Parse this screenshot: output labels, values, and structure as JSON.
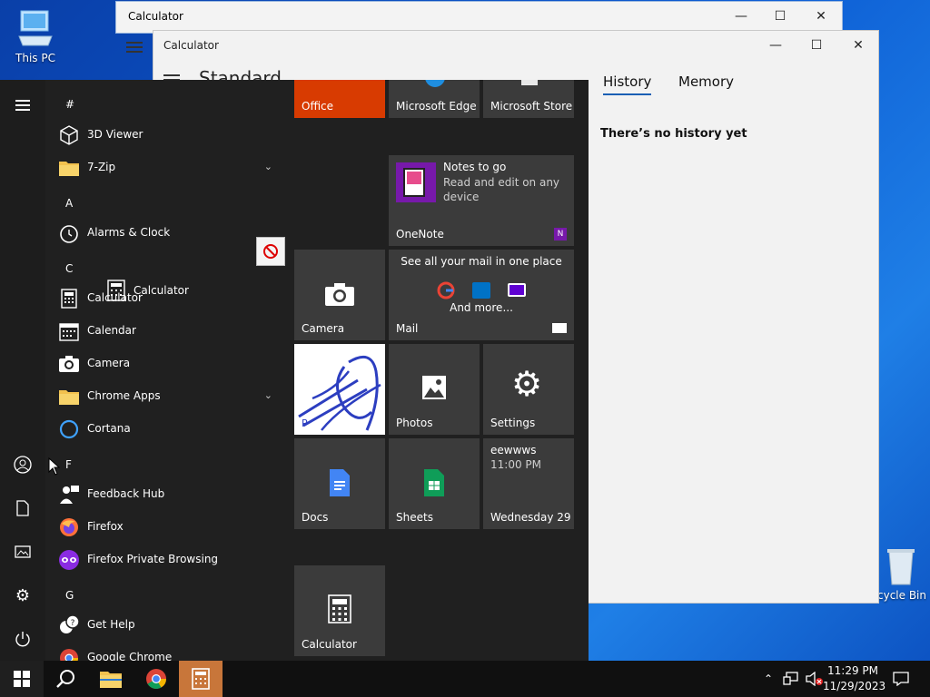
{
  "desktop": {
    "this_pc": "This PC",
    "recycle_bin": "cycle Bin"
  },
  "back_window": {
    "title": "Calculator"
  },
  "calculator": {
    "title": "Calculator",
    "mode": "Standard",
    "tab_history": "History",
    "tab_memory": "Memory",
    "history_empty": "There’s no history yet"
  },
  "start_menu": {
    "letters": [
      "#",
      "A",
      "C",
      "F",
      "G"
    ],
    "apps": [
      {
        "label": "3D Viewer",
        "icon": "cube-icon"
      },
      {
        "label": "7-Zip",
        "icon": "folder-icon",
        "expandable": true
      },
      {
        "label": "Alarms & Clock",
        "icon": "clock-icon"
      },
      {
        "label": "Calculator",
        "icon": "calculator-icon"
      },
      {
        "label": "Calendar",
        "icon": "calendar-icon"
      },
      {
        "label": "Camera",
        "icon": "camera-icon"
      },
      {
        "label": "Chrome Apps",
        "icon": "folder-icon",
        "expandable": true
      },
      {
        "label": "Cortana",
        "icon": "cortana-ring-icon"
      },
      {
        "label": "Feedback Hub",
        "icon": "feedback-icon"
      },
      {
        "label": "Firefox",
        "icon": "firefox-icon"
      },
      {
        "label": "Firefox Private Browsing",
        "icon": "firefox-private-icon"
      },
      {
        "label": "Get Help",
        "icon": "help-icon"
      },
      {
        "label": "Google Chrome",
        "icon": "chrome-icon"
      }
    ],
    "drag_ghost_label": "Calculator",
    "tiles": {
      "office": "Office",
      "edge": "Microsoft Edge",
      "store": "Microsoft Store",
      "onenote_title": "Notes to go",
      "onenote_sub": "Read and edit on any device",
      "onenote": "OneNote",
      "camera": "Camera",
      "mail_head": "See all your mail in one place",
      "mail_more": "And more...",
      "mail": "Mail",
      "paint_letter": "P",
      "photos": "Photos",
      "settings": "Settings",
      "docs": "Docs",
      "sheets": "Sheets",
      "cal_event": "eewwws",
      "cal_time": "11:00 PM",
      "cal_day": "Wednesday 29",
      "calculator": "Calculator"
    }
  },
  "taskbar": {
    "time": "11:29 PM",
    "date": "11/29/2023"
  },
  "colors": {
    "accent_office": "#d83b01",
    "taskbar_active": "#c8763a",
    "tile_bg": "#3b3b3b"
  }
}
